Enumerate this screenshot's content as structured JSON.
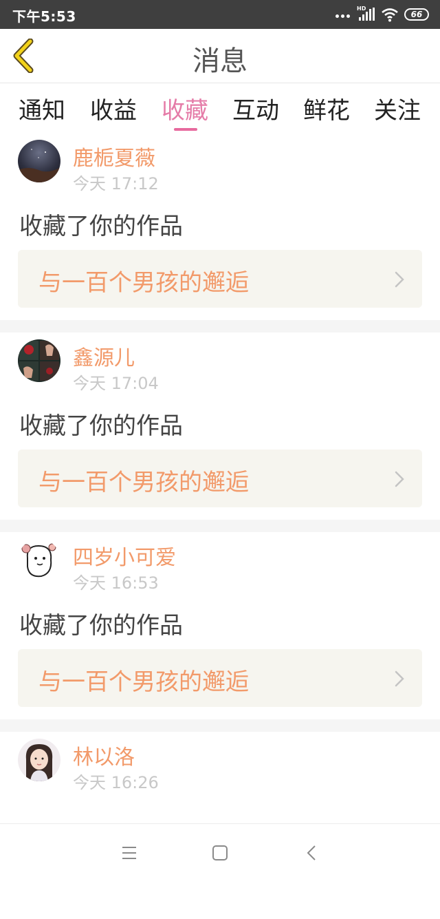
{
  "status_bar": {
    "time": "下午5:53",
    "network_label": "HD",
    "battery": "66"
  },
  "header": {
    "title": "消息"
  },
  "tabs": [
    {
      "label": "通知",
      "active": false
    },
    {
      "label": "收益",
      "active": false
    },
    {
      "label": "收藏",
      "active": true
    },
    {
      "label": "互动",
      "active": false
    },
    {
      "label": "鲜花",
      "active": false
    },
    {
      "label": "关注",
      "active": false
    }
  ],
  "colors": {
    "accent_tab": "#e57ca8",
    "username": "#f29a6a",
    "work_box_bg": "#f6f5ef"
  },
  "messages": [
    {
      "username": "鹿栀夏薇",
      "time": "今天 17:12",
      "action": "收藏了你的作品",
      "work_title": "与一百个男孩的邂逅"
    },
    {
      "username": "鑫源儿",
      "time": "今天 17:04",
      "action": "收藏了你的作品",
      "work_title": "与一百个男孩的邂逅"
    },
    {
      "username": "四岁小可爱",
      "time": "今天 16:53",
      "action": "收藏了你的作品",
      "work_title": "与一百个男孩的邂逅"
    },
    {
      "username": "林以洛",
      "time": "今天 16:26",
      "action": "",
      "work_title": ""
    }
  ],
  "icons": {
    "back": "chevron-left-icon",
    "menu": "menu-icon",
    "home": "home-square-icon",
    "nav_back": "nav-back-icon"
  }
}
